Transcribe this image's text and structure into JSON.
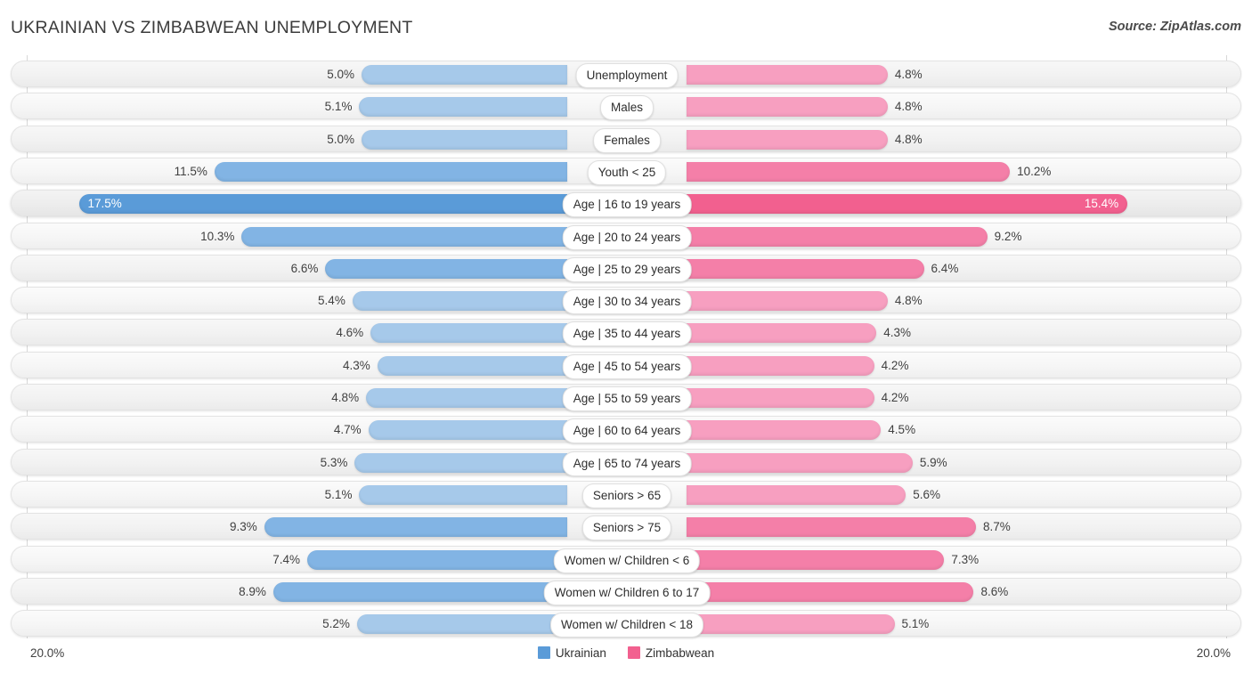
{
  "header": {
    "title": "UKRAINIAN VS ZIMBABWEAN UNEMPLOYMENT",
    "source": "Source: ZipAtlas.com"
  },
  "axis": {
    "left_label": "20.0%",
    "right_label": "20.0%",
    "max": 20.0
  },
  "legend": {
    "items": [
      {
        "label": "Ukrainian",
        "color": "#5a9bd8"
      },
      {
        "label": "Zimbabwean",
        "color": "#f2608f"
      }
    ]
  },
  "colors": {
    "left_light": "#a6c9ea",
    "left_mid": "#82b4e4",
    "left_dark": "#5a9bd8",
    "right_light": "#f79fc0",
    "right_mid": "#f47fa8",
    "right_dark": "#f2608f",
    "track": "#f2f2f2",
    "gridline": "#d8d8d8"
  },
  "chart_data": {
    "type": "bar",
    "title": "UKRAINIAN VS ZIMBABWEAN UNEMPLOYMENT",
    "subtitle": "",
    "xlabel": "",
    "ylabel": "",
    "orientation": "horizontal-diverging",
    "grid": false,
    "legend_position": "bottom-center",
    "xlim": [
      20.0,
      20.0
    ],
    "categories": [
      "Unemployment",
      "Males",
      "Females",
      "Youth < 25",
      "Age | 16 to 19 years",
      "Age | 20 to 24 years",
      "Age | 25 to 29 years",
      "Age | 30 to 34 years",
      "Age | 35 to 44 years",
      "Age | 45 to 54 years",
      "Age | 55 to 59 years",
      "Age | 60 to 64 years",
      "Age | 65 to 74 years",
      "Seniors > 65",
      "Seniors > 75",
      "Women w/ Children < 6",
      "Women w/ Children 6 to 17",
      "Women w/ Children < 18"
    ],
    "series": [
      {
        "name": "Ukrainian",
        "color": "#5a9bd8",
        "values": [
          5.0,
          5.1,
          5.0,
          11.5,
          17.5,
          10.3,
          6.6,
          5.4,
          4.6,
          4.3,
          4.8,
          4.7,
          5.3,
          5.1,
          9.3,
          7.4,
          8.9,
          5.2
        ],
        "labels": [
          "5.0%",
          "5.1%",
          "5.0%",
          "11.5%",
          "17.5%",
          "10.3%",
          "6.6%",
          "5.4%",
          "4.6%",
          "4.3%",
          "4.8%",
          "4.7%",
          "5.3%",
          "5.1%",
          "9.3%",
          "7.4%",
          "8.9%",
          "5.2%"
        ]
      },
      {
        "name": "Zimbabwean",
        "color": "#f2608f",
        "values": [
          4.8,
          4.8,
          4.8,
          10.2,
          15.4,
          9.2,
          6.4,
          4.8,
          4.3,
          4.2,
          4.2,
          4.5,
          5.9,
          5.6,
          8.7,
          7.3,
          8.6,
          5.1
        ],
        "labels": [
          "4.8%",
          "4.8%",
          "4.8%",
          "10.2%",
          "15.4%",
          "9.2%",
          "6.4%",
          "4.8%",
          "4.3%",
          "4.2%",
          "4.2%",
          "4.5%",
          "5.9%",
          "5.6%",
          "8.7%",
          "7.3%",
          "8.6%",
          "5.1%"
        ]
      }
    ]
  },
  "rows": [
    {
      "label": "Unemployment",
      "left": "5.0%",
      "right": "4.8%",
      "left_val": 5.0,
      "right_val": 4.8,
      "shade": "light",
      "inside": false
    },
    {
      "label": "Males",
      "left": "5.1%",
      "right": "4.8%",
      "left_val": 5.1,
      "right_val": 4.8,
      "shade": "light",
      "inside": false
    },
    {
      "label": "Females",
      "left": "5.0%",
      "right": "4.8%",
      "left_val": 5.0,
      "right_val": 4.8,
      "shade": "light",
      "inside": false
    },
    {
      "label": "Youth < 25",
      "left": "11.5%",
      "right": "10.2%",
      "left_val": 11.5,
      "right_val": 10.2,
      "shade": "mid",
      "inside": false
    },
    {
      "label": "Age | 16 to 19 years",
      "left": "17.5%",
      "right": "15.4%",
      "left_val": 17.5,
      "right_val": 15.4,
      "shade": "dark",
      "inside": true
    },
    {
      "label": "Age | 20 to 24 years",
      "left": "10.3%",
      "right": "9.2%",
      "left_val": 10.3,
      "right_val": 9.2,
      "shade": "mid",
      "inside": false
    },
    {
      "label": "Age | 25 to 29 years",
      "left": "6.6%",
      "right": "6.4%",
      "left_val": 6.6,
      "right_val": 6.4,
      "shade": "mid",
      "inside": false
    },
    {
      "label": "Age | 30 to 34 years",
      "left": "5.4%",
      "right": "4.8%",
      "left_val": 5.4,
      "right_val": 4.8,
      "shade": "light",
      "inside": false
    },
    {
      "label": "Age | 35 to 44 years",
      "left": "4.6%",
      "right": "4.3%",
      "left_val": 4.6,
      "right_val": 4.3,
      "shade": "light",
      "inside": false
    },
    {
      "label": "Age | 45 to 54 years",
      "left": "4.3%",
      "right": "4.2%",
      "left_val": 4.3,
      "right_val": 4.2,
      "shade": "light",
      "inside": false
    },
    {
      "label": "Age | 55 to 59 years",
      "left": "4.8%",
      "right": "4.2%",
      "left_val": 4.8,
      "right_val": 4.2,
      "shade": "light",
      "inside": false
    },
    {
      "label": "Age | 60 to 64 years",
      "left": "4.7%",
      "right": "4.5%",
      "left_val": 4.7,
      "right_val": 4.5,
      "shade": "light",
      "inside": false
    },
    {
      "label": "Age | 65 to 74 years",
      "left": "5.3%",
      "right": "5.9%",
      "left_val": 5.3,
      "right_val": 5.9,
      "shade": "light",
      "inside": false
    },
    {
      "label": "Seniors > 65",
      "left": "5.1%",
      "right": "5.6%",
      "left_val": 5.1,
      "right_val": 5.6,
      "shade": "light",
      "inside": false
    },
    {
      "label": "Seniors > 75",
      "left": "9.3%",
      "right": "8.7%",
      "left_val": 9.3,
      "right_val": 8.7,
      "shade": "mid",
      "inside": false
    },
    {
      "label": "Women w/ Children < 6",
      "left": "7.4%",
      "right": "7.3%",
      "left_val": 7.4,
      "right_val": 7.3,
      "shade": "mid",
      "inside": false
    },
    {
      "label": "Women w/ Children 6 to 17",
      "left": "8.9%",
      "right": "8.6%",
      "left_val": 8.9,
      "right_val": 8.6,
      "shade": "mid",
      "inside": false
    },
    {
      "label": "Women w/ Children < 18",
      "left": "5.2%",
      "right": "5.1%",
      "left_val": 5.2,
      "right_val": 5.1,
      "shade": "light",
      "inside": false
    }
  ]
}
